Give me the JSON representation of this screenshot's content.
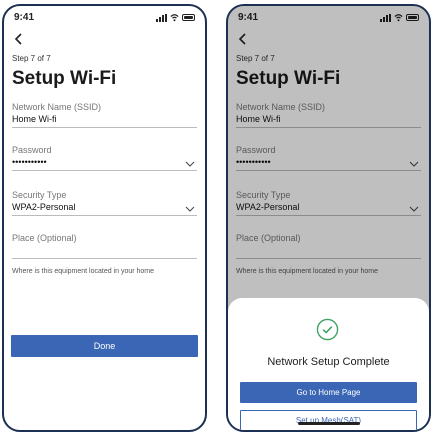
{
  "status": {
    "time": "9:41"
  },
  "form": {
    "step": "Step 7 of 7",
    "title": "Setup Wi-Fi",
    "ssid_label": "Network Name (SSID)",
    "ssid_value": "Home Wi-fi",
    "password_label": "Password",
    "password_value": "•••••••••••",
    "security_label": "Security Type",
    "security_value": "WPA2-Personal",
    "place_label": "Place (Optional)",
    "place_value": "",
    "place_helper": "Where is this equipment located in your home",
    "done_label": "Done"
  },
  "sheet": {
    "message": "Network Setup Complete",
    "home_button": "Go to Home Page",
    "mesh_button": "Set up Mesh(SAT)"
  },
  "colors": {
    "primary": "#3a66b5",
    "frame": "#1c3052",
    "success": "#3aa060"
  },
  "icons": [
    "back-arrow-icon",
    "chevron-down-icon",
    "check-circle-icon",
    "signal-icon",
    "wifi-icon",
    "battery-icon"
  ]
}
